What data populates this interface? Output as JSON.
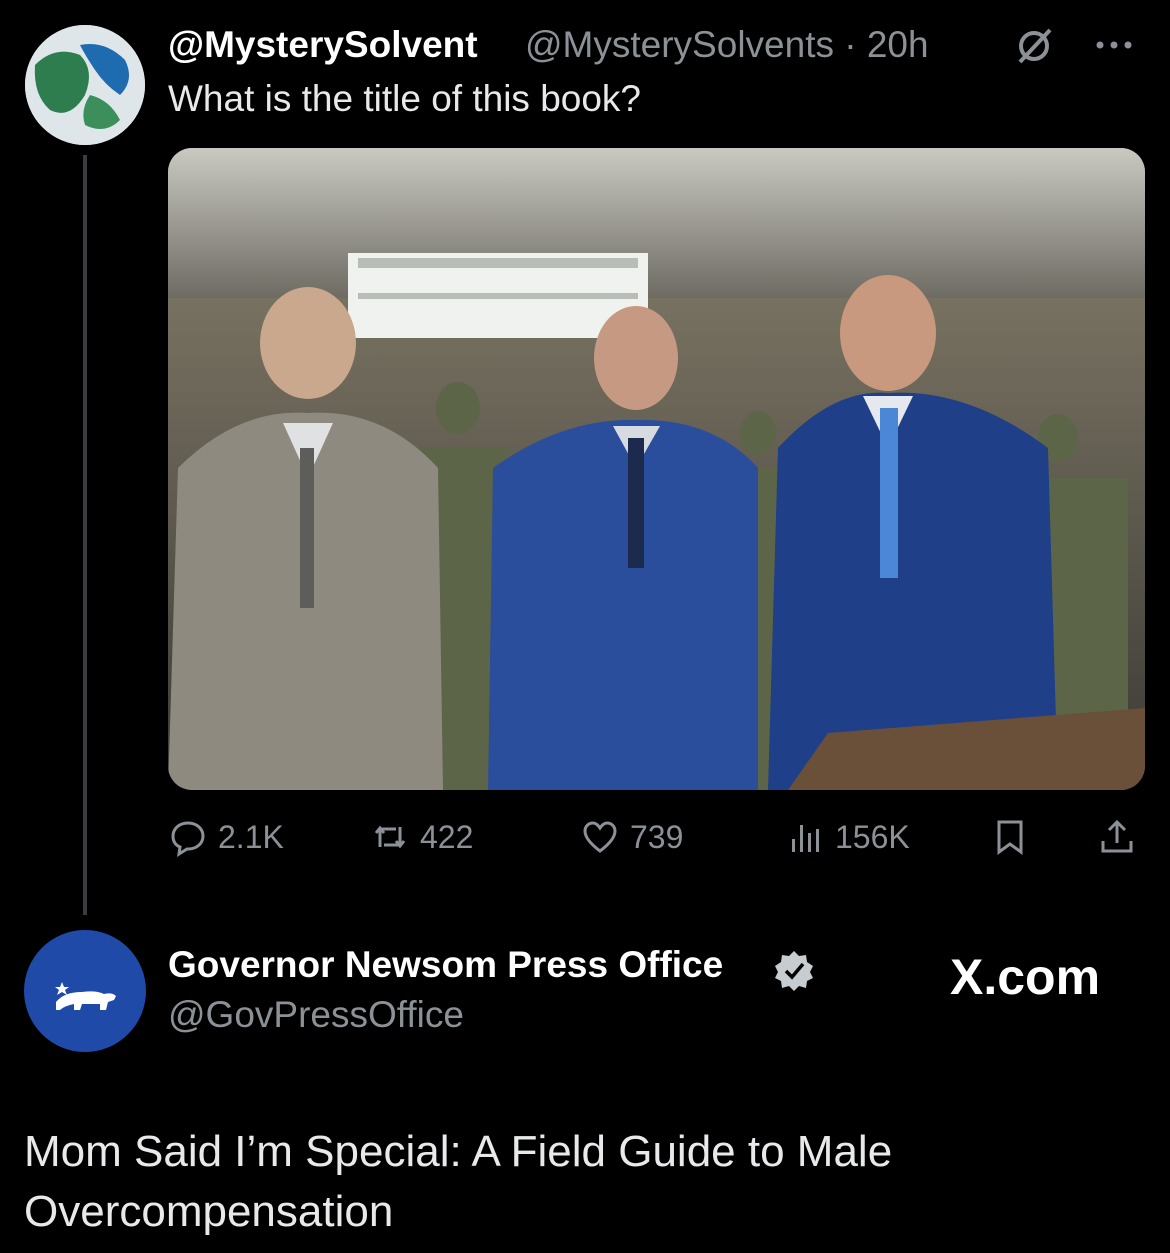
{
  "tweet": {
    "display_name": "@MysterySolvent",
    "handle_time": "@MysterySolvents · 20h",
    "text": "What is the title of this book?",
    "stats": {
      "replies": "2.1K",
      "reposts": "422",
      "likes": "739",
      "views": "156K"
    }
  },
  "reply": {
    "display_name": "Governor Newsom Press Office",
    "handle": "@GovPressOffice",
    "site_label": "X.com",
    "text": "Mom Said I’m Special: A Field Guide to Male Overcompensation"
  },
  "colors": {
    "background": "#000000",
    "muted": "#8b9196",
    "verified_badge": "#c7ccd1",
    "avatar_blue": "#1f4aa8"
  },
  "icons": [
    "grok-icon",
    "more-icon",
    "reply-icon",
    "repost-icon",
    "like-icon",
    "views-icon",
    "bookmark-icon",
    "share-icon",
    "verified-badge-icon",
    "bear-icon"
  ]
}
